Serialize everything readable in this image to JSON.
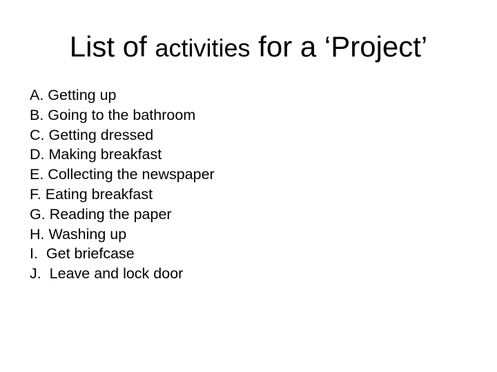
{
  "slide": {
    "title_parts": [
      "List of ",
      "activities",
      " for a ‘Project’"
    ],
    "items": [
      "A. Getting up",
      "B. Going to the bathroom",
      "C. Getting dressed",
      "D. Making breakfast",
      "E. Collecting the newspaper",
      "F. Eating breakfast",
      "G. Reading the paper",
      "H. Washing up",
      "I.  Get briefcase",
      "J.  Leave and lock door"
    ]
  }
}
